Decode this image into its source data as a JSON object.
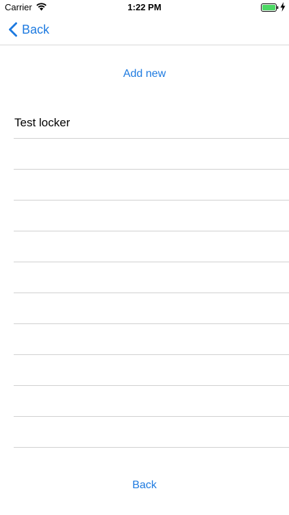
{
  "status_bar": {
    "carrier": "Carrier",
    "time": "1:22 PM",
    "icons": [
      "wifi-icon",
      "battery-icon",
      "charging-bolt-icon"
    ]
  },
  "nav": {
    "back_label": "Back",
    "accent_color": "#1d7ae0"
  },
  "actions": {
    "add_new_label": "Add new",
    "back_label": "Back"
  },
  "list": {
    "items": [
      "Test locker",
      "",
      "",
      "",
      "",
      "",
      "",
      "",
      "",
      "",
      ""
    ]
  }
}
